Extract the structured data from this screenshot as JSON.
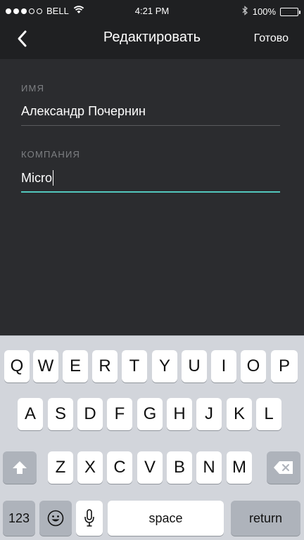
{
  "status_bar": {
    "carrier": "BELL",
    "time": "4:21 PM",
    "battery": "100%",
    "signal_filled": 3,
    "signal_total": 5,
    "icons": [
      "wifi-icon",
      "bluetooth-icon",
      "battery-icon"
    ]
  },
  "nav": {
    "title": "Редактировать",
    "done_label": "Готово",
    "back_icon": "chevron-left-icon"
  },
  "form": {
    "name_label": "ИМЯ",
    "name_value": "Александр Почернин",
    "company_label": "КОМПАНИЯ",
    "company_value": "Micro"
  },
  "keyboard": {
    "row1": [
      "Q",
      "W",
      "E",
      "R",
      "T",
      "Y",
      "U",
      "I",
      "O",
      "P"
    ],
    "row2": [
      "A",
      "S",
      "D",
      "F",
      "G",
      "H",
      "J",
      "K",
      "L"
    ],
    "row3": [
      "Z",
      "X",
      "C",
      "V",
      "B",
      "N",
      "M"
    ],
    "numbers_label": "123",
    "space_label": "space",
    "return_label": "return",
    "icons": [
      "shift-icon",
      "backspace-icon",
      "emoji-icon",
      "microphone-icon"
    ]
  },
  "colors": {
    "background": "#2b2c2f",
    "nav_background": "#1f2022",
    "accent": "#52c8bd",
    "label": "#7e8083",
    "keyboard_background": "#d2d5db"
  }
}
